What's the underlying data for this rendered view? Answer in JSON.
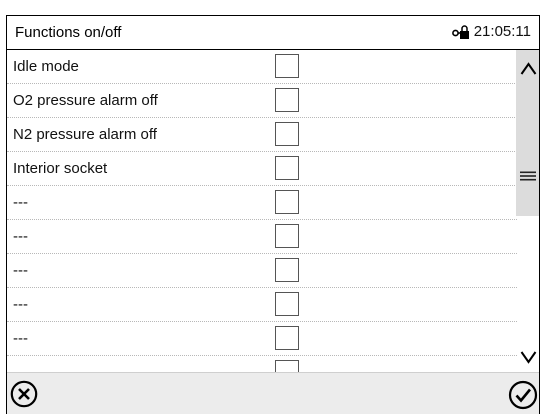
{
  "header": {
    "title": "Functions on/off",
    "time": "21:05:11",
    "lock_icon": "lock-key-icon"
  },
  "rows": [
    {
      "label": "Idle mode",
      "checked": false
    },
    {
      "label": "O2 pressure alarm off",
      "checked": false
    },
    {
      "label": "N2 pressure alarm off",
      "checked": false
    },
    {
      "label": "Interior socket",
      "checked": false
    },
    {
      "label": "---",
      "checked": false
    },
    {
      "label": "---",
      "checked": false
    },
    {
      "label": "---",
      "checked": false
    },
    {
      "label": "---",
      "checked": false
    },
    {
      "label": "---",
      "checked": false
    },
    {
      "label": "",
      "checked": false
    }
  ],
  "scrollbar": {
    "up_icon": "chevron-up-icon",
    "down_icon": "chevron-down-icon",
    "grip_icon": "menu-grip-icon"
  },
  "footer": {
    "cancel_icon": "cancel-circle-x-icon",
    "confirm_icon": "confirm-circle-check-icon"
  },
  "colors": {
    "border": "#000000",
    "footer_bg": "#ececec",
    "scroll_thumb": "#dcdcdc",
    "row_divider": "#b8b8b8"
  }
}
